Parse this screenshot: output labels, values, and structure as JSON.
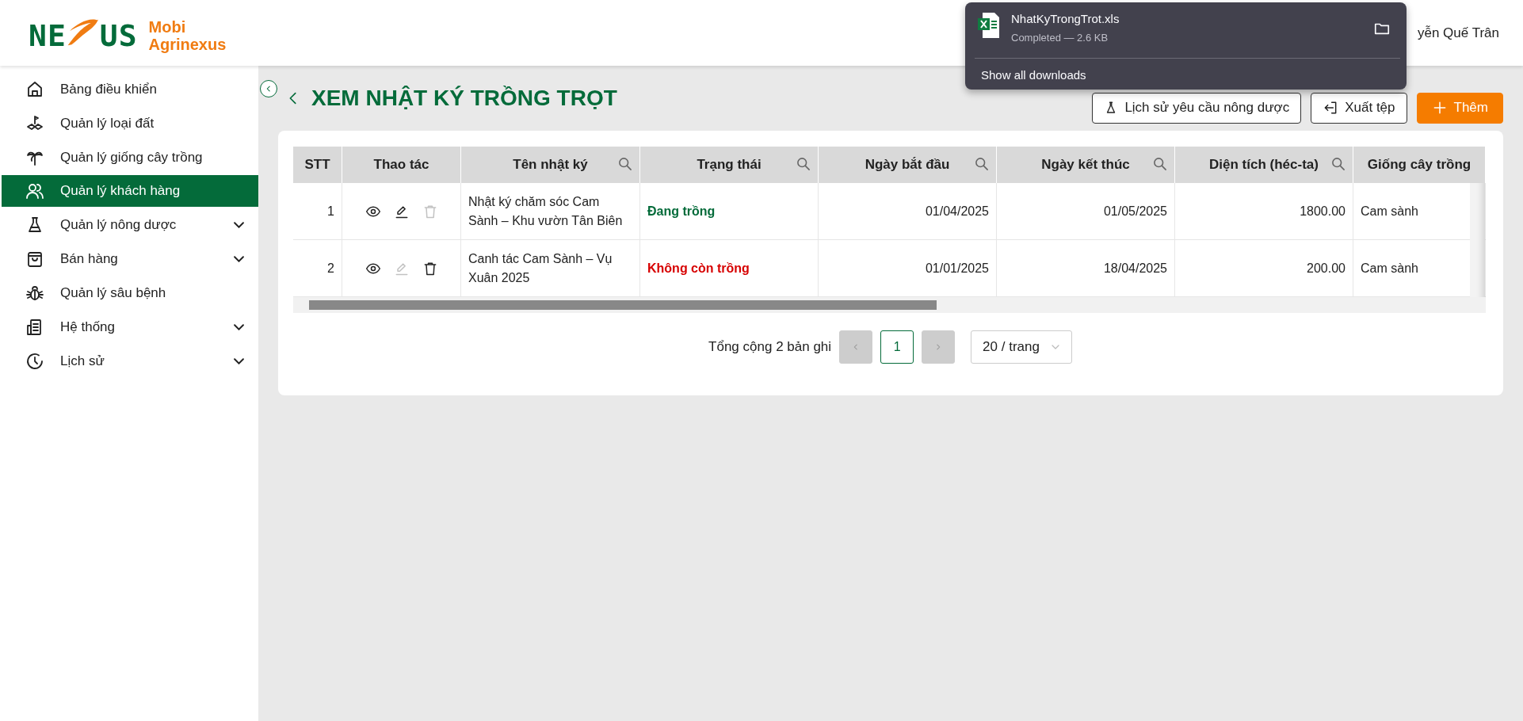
{
  "logo": {
    "mark_start": "NE",
    "mark_end": "US",
    "brand_line_1": "Mobi",
    "brand_line_2": "Agrinexus"
  },
  "user": {
    "name": "yễn Quế Trân"
  },
  "sidebar": {
    "items": [
      {
        "label": "Bảng điều khiển",
        "selected": false,
        "expandable": false
      },
      {
        "label": "Quản lý loại đất",
        "selected": false,
        "expandable": false
      },
      {
        "label": "Quản lý giống cây trồng",
        "selected": false,
        "expandable": false
      },
      {
        "label": "Quản lý khách hàng",
        "selected": true,
        "expandable": false
      },
      {
        "label": "Quản lý nông dược",
        "selected": false,
        "expandable": true
      },
      {
        "label": "Bán hàng",
        "selected": false,
        "expandable": true
      },
      {
        "label": "Quản lý sâu bệnh",
        "selected": false,
        "expandable": false
      },
      {
        "label": "Hệ thống",
        "selected": false,
        "expandable": true
      },
      {
        "label": "Lịch sử",
        "selected": false,
        "expandable": true
      }
    ]
  },
  "page": {
    "title": "XEM NHẬT KÝ TRỒNG TRỌT"
  },
  "toolbar": {
    "buttons": [
      {
        "label": "Lịch sử yêu cầu nông dược",
        "kind": "history"
      },
      {
        "label": "Xuất tệp",
        "kind": "export"
      },
      {
        "label": "Thêm",
        "kind": "add"
      }
    ]
  },
  "table": {
    "columns": [
      {
        "label": "STT",
        "searchable": false
      },
      {
        "label": "Thao tác",
        "searchable": false
      },
      {
        "label": "Tên nhật ký",
        "searchable": true
      },
      {
        "label": "Trạng thái",
        "searchable": true
      },
      {
        "label": "Ngày bắt đầu",
        "searchable": true
      },
      {
        "label": "Ngày kết thúc",
        "searchable": true
      },
      {
        "label": "Diện tích (héc-ta)",
        "searchable": true
      },
      {
        "label": "Giống cây trồng",
        "searchable": false
      }
    ],
    "rows": [
      {
        "stt": "1",
        "edit_disabled": false,
        "delete_disabled": true,
        "name": "Nhật ký chăm sóc Cam Sành – Khu vườn Tân Biên",
        "status": {
          "label": "Đang trồng",
          "color": "#046b3a"
        },
        "start": "01/04/2025",
        "end": "01/05/2025",
        "area": "1800.00",
        "variety": "Cam sành"
      },
      {
        "stt": "2",
        "edit_disabled": true,
        "delete_disabled": false,
        "name": "Canh tác Cam Sành – Vụ Xuân 2025",
        "status": {
          "label": "Không còn trồng",
          "color": "#d70000"
        },
        "start": "01/01/2025",
        "end": "18/04/2025",
        "area": "200.00",
        "variety": "Cam sành"
      }
    ]
  },
  "pagination": {
    "total": "Tổng cộng 2 bản ghi",
    "prev_disabled": true,
    "next_disabled": true,
    "pages": [
      {
        "label": "1",
        "selected": true
      }
    ],
    "page_size": "20 / trang"
  },
  "download_popup": {
    "file_name": "NhatKyTrongTrot.xls",
    "status": "Completed — 2.6 KB",
    "show_all": "Show all downloads"
  }
}
